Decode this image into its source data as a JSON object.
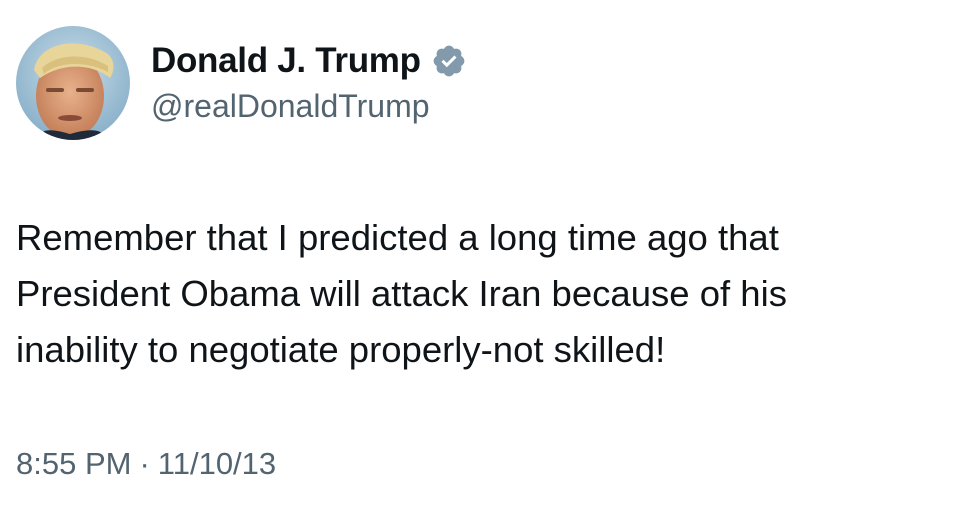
{
  "author": {
    "display_name": "Donald J. Trump",
    "handle": "@realDonaldTrump",
    "verified": true,
    "avatar_icon": "profile-photo",
    "verified_icon": "verified-badge-icon"
  },
  "tweet": {
    "text_lines": [
      "Remember that I predicted a long time ago that",
      "President Obama will attack Iran because of his",
      "inability to negotiate properly-not skilled!"
    ]
  },
  "meta": {
    "time": "8:55 PM",
    "separator": "·",
    "date": "11/10/13"
  },
  "colors": {
    "text_primary": "#0f1419",
    "text_secondary": "#536471",
    "verified_badge": "#829aab",
    "background": "#ffffff"
  }
}
